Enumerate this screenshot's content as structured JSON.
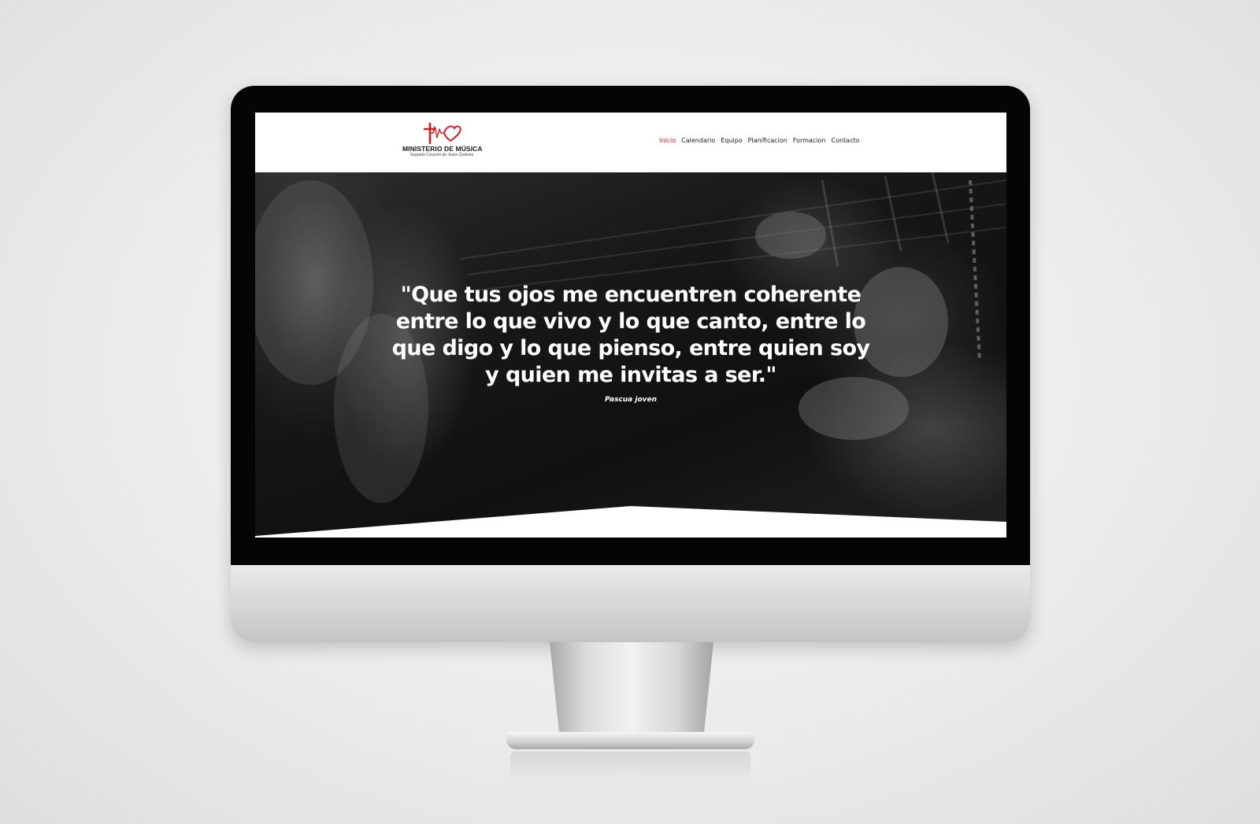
{
  "site": {
    "logo": {
      "title": "MINISTERIO DE MÚSICA",
      "subtitle": "Sagrado Corazón de Jesús Quilmes",
      "icon": "cross-heartbeat-heart-icon",
      "color": "#d31c23"
    },
    "nav": [
      {
        "label": "Inicio",
        "active": true
      },
      {
        "label": "Calendario",
        "active": false
      },
      {
        "label": "Equipo",
        "active": false
      },
      {
        "label": "Planificacion",
        "active": false
      },
      {
        "label": "Formacion",
        "active": false
      },
      {
        "label": "Contacto",
        "active": false
      }
    ],
    "accent_color": "#d31c23"
  },
  "hero": {
    "quote": "\"Que tus ojos me encuentren coherente entre lo que vivo y lo que canto, entre lo que digo y lo que pienso, entre quien soy y quien me invitas a ser.\"",
    "author": "Pascua joven",
    "background": "black-and-white guitar player photo"
  },
  "device": {
    "type": "desktop monitor mockup",
    "bezel_color": "#050505",
    "chin_color": "#d9d9db",
    "background_color": "#ececec"
  }
}
